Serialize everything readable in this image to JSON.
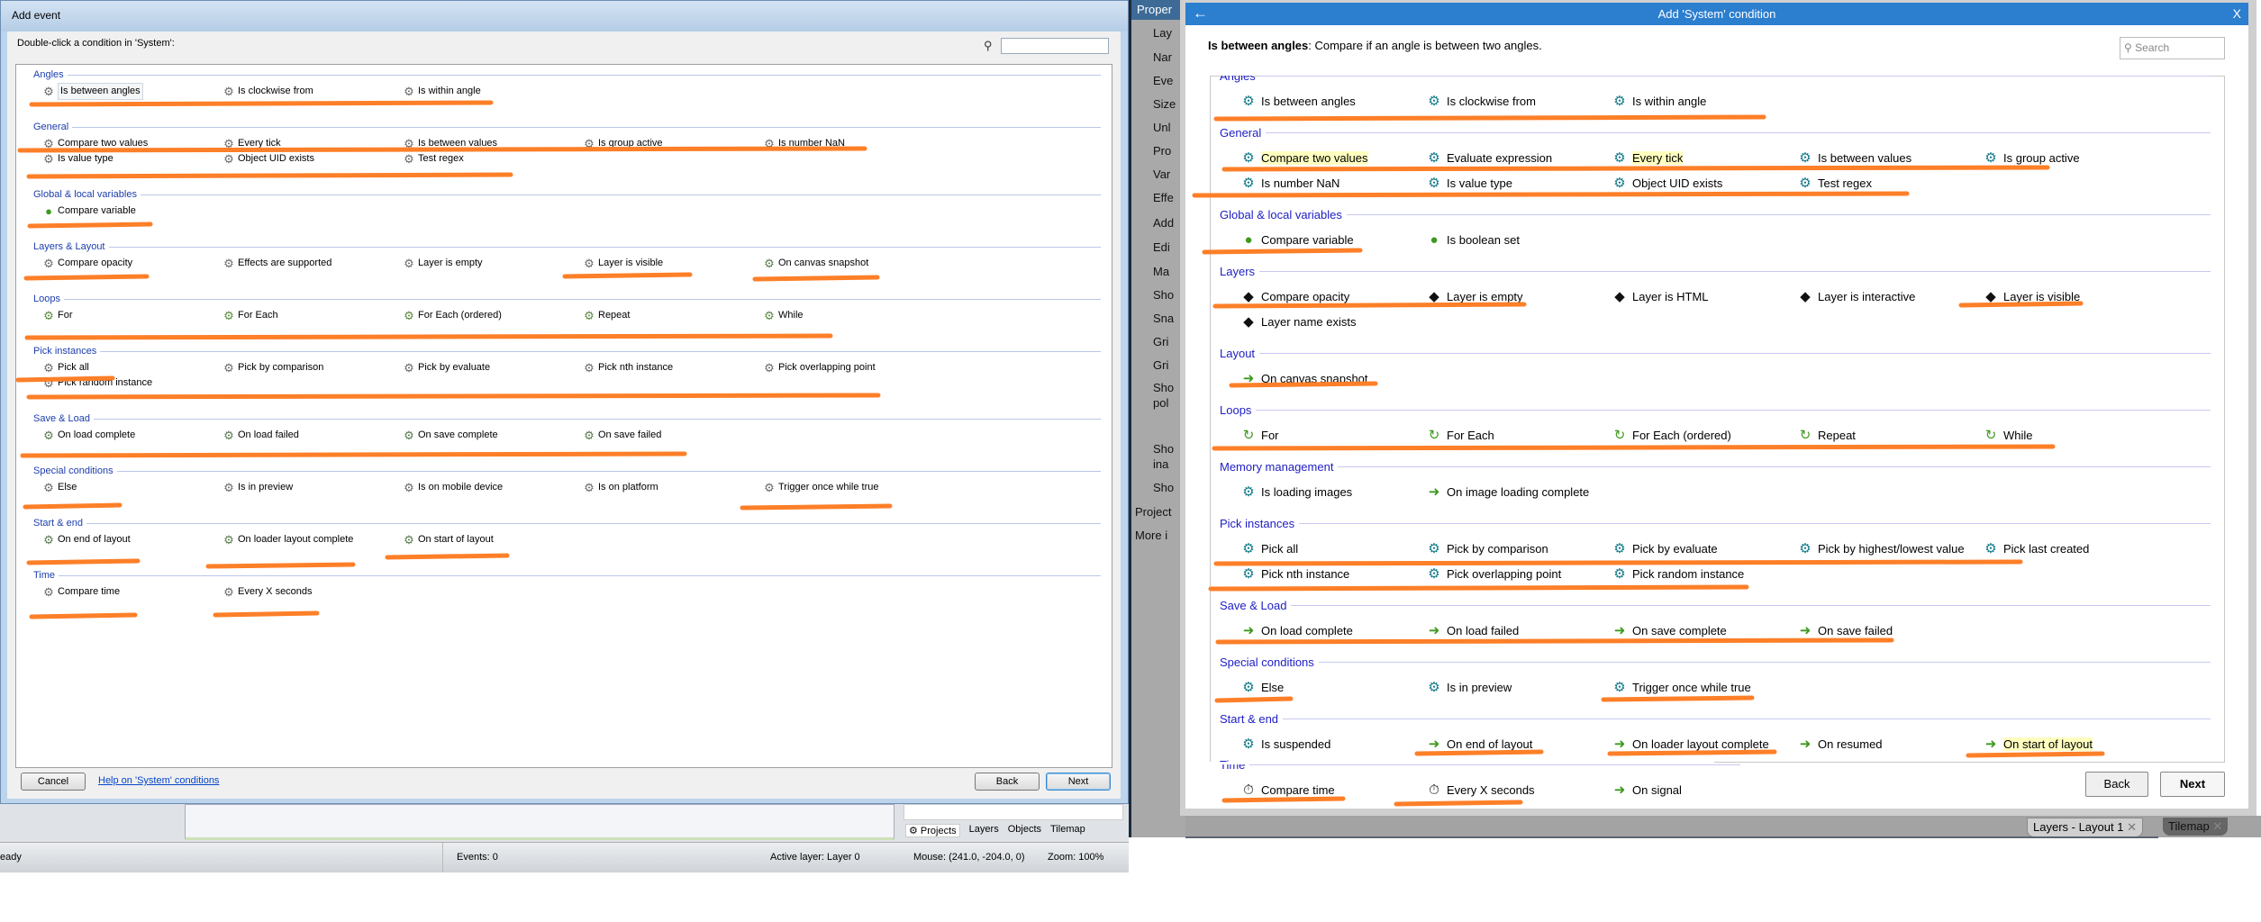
{
  "left_dialog": {
    "title": "Add event",
    "prompt": "Double-click a condition in 'System':",
    "cancel_label": "Cancel",
    "help_link": "Help on 'System' conditions",
    "back_label": "Back",
    "next_label": "Next",
    "categories": [
      {
        "name": "Angles",
        "items": [
          {
            "label": "Is between angles",
            "icon": "gear",
            "selected": true
          },
          {
            "label": "Is clockwise from",
            "icon": "gear"
          },
          {
            "label": "Is within angle",
            "icon": "gear"
          }
        ]
      },
      {
        "name": "General",
        "items": [
          {
            "label": "Compare two values",
            "icon": "gear"
          },
          {
            "label": "Every tick",
            "icon": "gear"
          },
          {
            "label": "Is between values",
            "icon": "gear"
          },
          {
            "label": "Is group active",
            "icon": "gear"
          },
          {
            "label": "Is number NaN",
            "icon": "gear"
          },
          {
            "label": "Is value type",
            "icon": "gear"
          },
          {
            "label": "Object UID exists",
            "icon": "gear"
          },
          {
            "label": "Test regex",
            "icon": "gear"
          }
        ]
      },
      {
        "name": "Global & local variables",
        "items": [
          {
            "label": "Compare variable",
            "icon": "globe"
          }
        ]
      },
      {
        "name": "Layers & Layout",
        "items": [
          {
            "label": "Compare opacity",
            "icon": "gear"
          },
          {
            "label": "Effects are supported",
            "icon": "gear"
          },
          {
            "label": "Layer is empty",
            "icon": "gear"
          },
          {
            "label": "Layer is visible",
            "icon": "gear"
          },
          {
            "label": "On canvas snapshot",
            "icon": "gear-trigger"
          }
        ]
      },
      {
        "name": "Loops",
        "items": [
          {
            "label": "For",
            "icon": "gear-loop"
          },
          {
            "label": "For Each",
            "icon": "gear-loop"
          },
          {
            "label": "For Each (ordered)",
            "icon": "gear-loop"
          },
          {
            "label": "Repeat",
            "icon": "gear-loop"
          },
          {
            "label": "While",
            "icon": "gear-loop"
          }
        ]
      },
      {
        "name": "Pick instances",
        "items": [
          {
            "label": "Pick all",
            "icon": "gear"
          },
          {
            "label": "Pick by comparison",
            "icon": "gear"
          },
          {
            "label": "Pick by evaluate",
            "icon": "gear"
          },
          {
            "label": "Pick nth instance",
            "icon": "gear"
          },
          {
            "label": "Pick overlapping point",
            "icon": "gear"
          },
          {
            "label": "Pick random instance",
            "icon": "gear"
          }
        ]
      },
      {
        "name": "Save & Load",
        "items": [
          {
            "label": "On load complete",
            "icon": "gear-trigger"
          },
          {
            "label": "On load failed",
            "icon": "gear-trigger"
          },
          {
            "label": "On save complete",
            "icon": "gear-trigger"
          },
          {
            "label": "On save failed",
            "icon": "gear-trigger"
          }
        ]
      },
      {
        "name": "Special conditions",
        "items": [
          {
            "label": "Else",
            "icon": "gear"
          },
          {
            "label": "Is in preview",
            "icon": "gear"
          },
          {
            "label": "Is on mobile device",
            "icon": "gear"
          },
          {
            "label": "Is on platform",
            "icon": "gear"
          },
          {
            "label": "Trigger once while true",
            "icon": "gear"
          }
        ]
      },
      {
        "name": "Start & end",
        "items": [
          {
            "label": "On end of layout",
            "icon": "gear-trigger"
          },
          {
            "label": "On loader layout complete",
            "icon": "gear-trigger"
          },
          {
            "label": "On start of layout",
            "icon": "gear-trigger"
          }
        ]
      },
      {
        "name": "Time",
        "items": [
          {
            "label": "Compare time",
            "icon": "gear"
          },
          {
            "label": "Every X seconds",
            "icon": "gear"
          }
        ]
      }
    ]
  },
  "app_behind": {
    "bottom_tabs": [
      "Projects",
      "Layers",
      "Objects",
      "Tilemap"
    ],
    "status": {
      "text": "eady",
      "events": "Events: 0",
      "active_layer": "Active layer: Layer 0",
      "mouse": "Mouse: (241.0, -204.0, 0)",
      "zoom": "Zoom: 100%"
    },
    "properties_header": "Proper",
    "property_labels": [
      "Lay",
      "Nar",
      "Eve",
      "Size",
      "Unl",
      "Pro",
      "Var",
      "Effe",
      "Add",
      "Edi",
      "Ma",
      "Sho",
      "Sna",
      "Gri",
      "Gri",
      "Sho",
      "pol",
      "Sho",
      "ina",
      "Sho",
      "Project",
      "More i"
    ],
    "right_tabs": [
      "Layers - Layout 1",
      "Tilemap"
    ]
  },
  "right_dialog": {
    "title": "Add 'System' condition",
    "description_name": "Is between angles",
    "description_text": ": Compare if an angle is between two angles.",
    "search_placeholder": "Search",
    "back_label": "Back",
    "next_label": "Next",
    "categories": [
      {
        "name": "Angles",
        "items": [
          {
            "label": "Is between angles",
            "icon": "gear"
          },
          {
            "label": "Is clockwise from",
            "icon": "gear"
          },
          {
            "label": "Is within angle",
            "icon": "gear"
          }
        ]
      },
      {
        "name": "General",
        "items": [
          {
            "label": "Compare two values",
            "icon": "gear",
            "highlight": true
          },
          {
            "label": "Evaluate expression",
            "icon": "gear"
          },
          {
            "label": "Every tick",
            "icon": "gear",
            "highlight": true
          },
          {
            "label": "Is between values",
            "icon": "gear"
          },
          {
            "label": "Is group active",
            "icon": "gear"
          },
          {
            "label": "Is number NaN",
            "icon": "gear"
          },
          {
            "label": "Is value type",
            "icon": "gear"
          },
          {
            "label": "Object UID exists",
            "icon": "gear"
          },
          {
            "label": "Test regex",
            "icon": "gear"
          }
        ]
      },
      {
        "name": "Global & local variables",
        "items": [
          {
            "label": "Compare variable",
            "icon": "globe"
          },
          {
            "label": "Is boolean set",
            "icon": "globe"
          }
        ]
      },
      {
        "name": "Layers",
        "items": [
          {
            "label": "Compare opacity",
            "icon": "layers"
          },
          {
            "label": "Layer is empty",
            "icon": "layers"
          },
          {
            "label": "Layer is HTML",
            "icon": "layers"
          },
          {
            "label": "Layer is interactive",
            "icon": "layers"
          },
          {
            "label": "Layer is visible",
            "icon": "layers"
          },
          {
            "label": "Layer name exists",
            "icon": "layers"
          }
        ]
      },
      {
        "name": "Layout",
        "items": [
          {
            "label": "On canvas snapshot",
            "icon": "arrow"
          }
        ]
      },
      {
        "name": "Loops",
        "items": [
          {
            "label": "For",
            "icon": "loop"
          },
          {
            "label": "For Each",
            "icon": "loop"
          },
          {
            "label": "For Each (ordered)",
            "icon": "loop"
          },
          {
            "label": "Repeat",
            "icon": "loop"
          },
          {
            "label": "While",
            "icon": "loop"
          }
        ]
      },
      {
        "name": "Memory management",
        "items": [
          {
            "label": "Is loading images",
            "icon": "gear"
          },
          {
            "label": "On image loading complete",
            "icon": "arrow"
          }
        ]
      },
      {
        "name": "Pick instances",
        "items": [
          {
            "label": "Pick all",
            "icon": "gear"
          },
          {
            "label": "Pick by comparison",
            "icon": "gear"
          },
          {
            "label": "Pick by evaluate",
            "icon": "gear"
          },
          {
            "label": "Pick by highest/lowest value",
            "icon": "gear"
          },
          {
            "label": "Pick last created",
            "icon": "gear"
          },
          {
            "label": "Pick nth instance",
            "icon": "gear"
          },
          {
            "label": "Pick overlapping point",
            "icon": "gear"
          },
          {
            "label": "Pick random instance",
            "icon": "gear"
          }
        ]
      },
      {
        "name": "Save & Load",
        "items": [
          {
            "label": "On load complete",
            "icon": "arrow"
          },
          {
            "label": "On load failed",
            "icon": "arrow"
          },
          {
            "label": "On save complete",
            "icon": "arrow"
          },
          {
            "label": "On save failed",
            "icon": "arrow"
          }
        ]
      },
      {
        "name": "Special conditions",
        "items": [
          {
            "label": "Else",
            "icon": "gear"
          },
          {
            "label": "Is in preview",
            "icon": "gear"
          },
          {
            "label": "Trigger once while true",
            "icon": "gear"
          }
        ]
      },
      {
        "name": "Start & end",
        "items": [
          {
            "label": "Is suspended",
            "icon": "gear"
          },
          {
            "label": "On end of layout",
            "icon": "arrow"
          },
          {
            "label": "On loader layout complete",
            "icon": "arrow"
          },
          {
            "label": "On resumed",
            "icon": "arrow"
          },
          {
            "label": "On start of layout",
            "icon": "arrow",
            "highlight": true
          }
        ]
      },
      {
        "name": "Time",
        "items": [
          {
            "label": "Compare time",
            "icon": "stopwatch"
          },
          {
            "label": "Every X seconds",
            "icon": "stopwatch"
          },
          {
            "label": "On signal",
            "icon": "arrow"
          }
        ]
      }
    ]
  },
  "colors": {
    "accent": "#2c7ecf",
    "category": "#1d1dc4",
    "gear_teal": "#137a8a",
    "trigger_green": "#3d9a1e",
    "annotation": "#fd7f28",
    "highlight": "#ffffc0"
  }
}
